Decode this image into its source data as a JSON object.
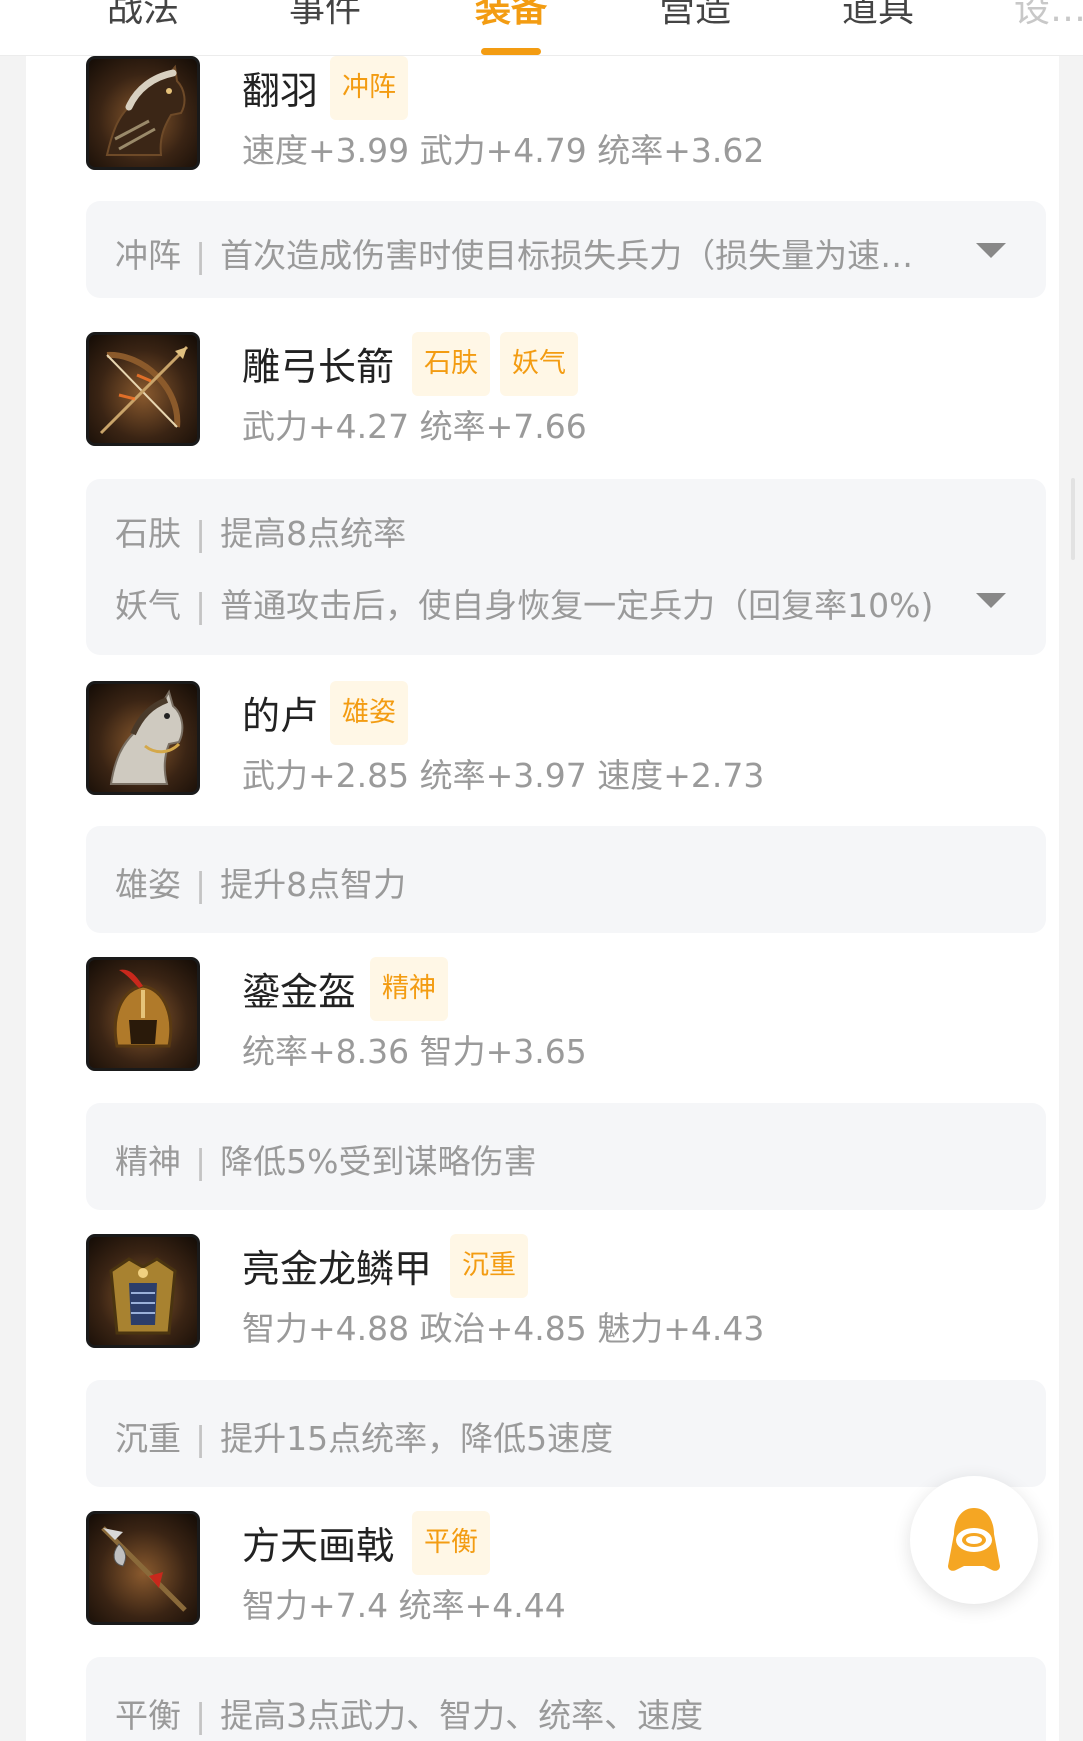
{
  "tabs": [
    {
      "label": "战法",
      "active": false
    },
    {
      "label": "事件",
      "active": false
    },
    {
      "label": "装备",
      "active": true
    },
    {
      "label": "营造",
      "active": false
    },
    {
      "label": "道具",
      "active": false
    },
    {
      "label": "设…",
      "active": false
    }
  ],
  "items": [
    {
      "name": "翻羽",
      "icon": "warhorse-icon",
      "tags": [
        "冲阵"
      ],
      "stats": "速度+3.99 武力+4.79 统率+3.62",
      "effects": [
        {
          "tag": "冲阵",
          "text": "首次造成伤害时使目标损失兵力（损失量为速度…"
        }
      ],
      "expandable": true
    },
    {
      "name": "雕弓长箭",
      "icon": "bow-arrow-icon",
      "tags": [
        "石肤",
        "妖气"
      ],
      "stats": "武力+4.27 统率+7.66",
      "effects": [
        {
          "tag": "石肤",
          "text": "提高8点统率"
        },
        {
          "tag": "妖气",
          "text": "普通攻击后，使自身恢复一定兵力（回复率10%)"
        }
      ],
      "expandable": true
    },
    {
      "name": "的卢",
      "icon": "white-horse-icon",
      "tags": [
        "雄姿"
      ],
      "stats": "武力+2.85 统率+3.97 速度+2.73",
      "effects": [
        {
          "tag": "雄姿",
          "text": "提升8点智力"
        }
      ],
      "expandable": false
    },
    {
      "name": "鎏金盔",
      "icon": "helmet-icon",
      "tags": [
        "精神"
      ],
      "stats": "统率+8.36 智力+3.65",
      "effects": [
        {
          "tag": "精神",
          "text": "降低5%受到谋略伤害"
        }
      ],
      "expandable": false
    },
    {
      "name": "亮金龙鳞甲",
      "icon": "armor-icon",
      "tags": [
        "沉重"
      ],
      "stats": "智力+4.88 政治+4.85 魅力+4.43",
      "effects": [
        {
          "tag": "沉重",
          "text": "提升15点统率，降低5速度"
        }
      ],
      "expandable": false
    },
    {
      "name": "方天画戟",
      "icon": "halberd-icon",
      "tags": [
        "平衡"
      ],
      "stats": "智力+7.4 统率+4.44",
      "effects": [
        {
          "tag": "平衡",
          "text": "提高3点武力、智力、统率、速度"
        }
      ],
      "expandable": false
    }
  ],
  "colors": {
    "accent": "#f39c12",
    "tag_bg": "#fff7e6",
    "desc_bg": "#f5f6f8",
    "muted_text": "#9a9a9a"
  },
  "fab": {
    "icon": "assistant-bot-icon"
  }
}
